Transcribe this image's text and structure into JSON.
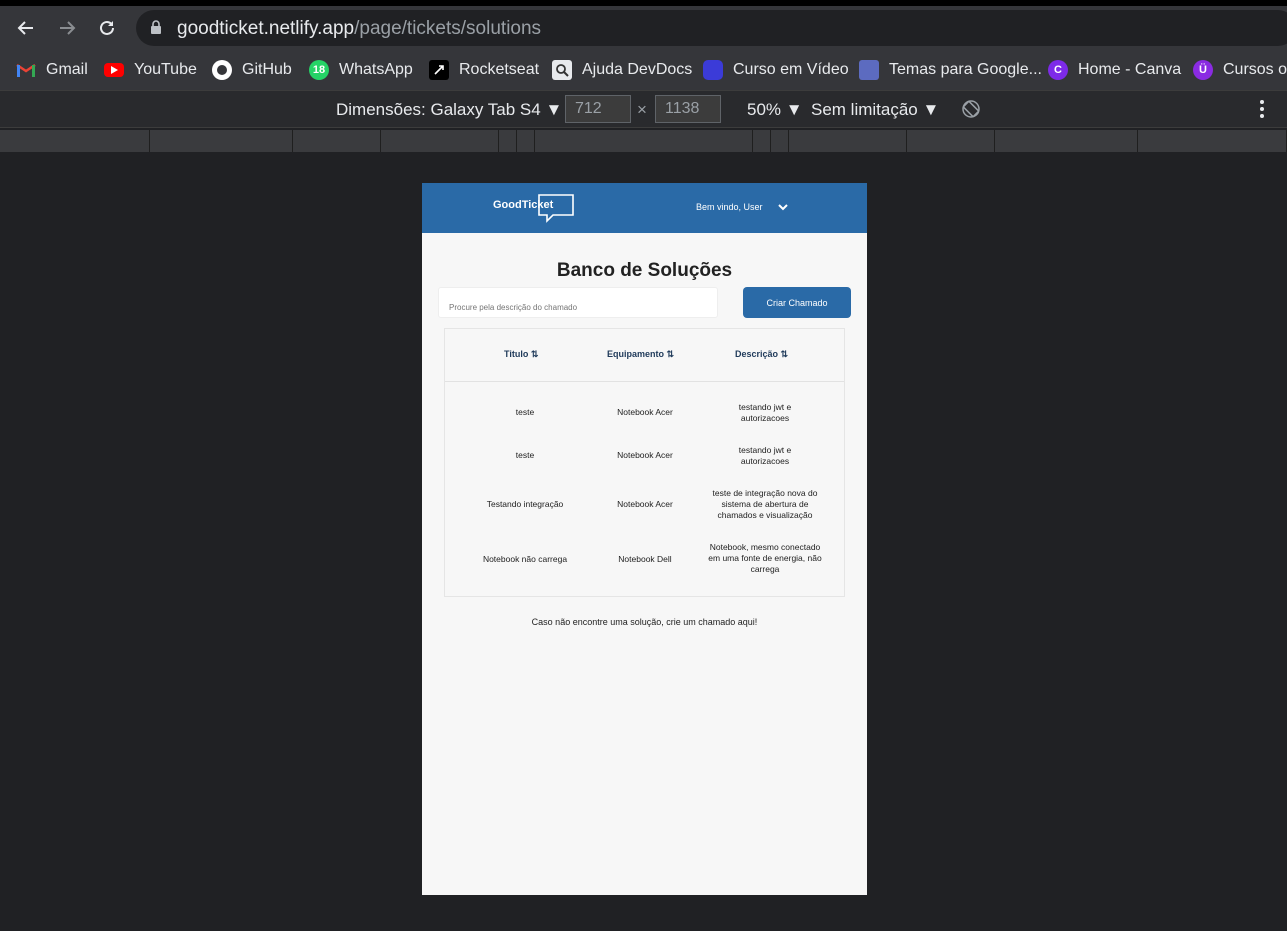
{
  "browser": {
    "url_host": "goodticket.netlify.app",
    "url_path": "/page/tickets/solutions",
    "bookmarks": [
      {
        "label": "Gmail",
        "icon": "gmail-icon"
      },
      {
        "label": "YouTube",
        "icon": "youtube-icon"
      },
      {
        "label": "GitHub",
        "icon": "github-icon"
      },
      {
        "label": "WhatsApp",
        "icon": "whatsapp-icon",
        "badge": "18"
      },
      {
        "label": "Rocketseat",
        "icon": "rocketseat-icon"
      },
      {
        "label": "Ajuda DevDocs",
        "icon": "devdocs-icon"
      },
      {
        "label": "Curso em Vídeo",
        "icon": "cursoemvideo-icon"
      },
      {
        "label": "Temas para Google...",
        "icon": "temas-icon"
      },
      {
        "label": "Home - Canva",
        "icon": "canva-icon",
        "badge": "C"
      },
      {
        "label": "Cursos on",
        "icon": "cursos-icon",
        "badge": "Ü"
      }
    ]
  },
  "devtools": {
    "device_label": "Dimensões: Galaxy Tab S4",
    "width_value": "712",
    "times_symbol": "×",
    "height_value": "1138",
    "zoom": "50%",
    "throttle": "Sem limitação"
  },
  "app": {
    "logo_text": "GoodTicket",
    "welcome": "Bem vindo, User",
    "page_title": "Banco de Soluções",
    "search_placeholder": "Procure pela descrição do chamado",
    "create_button": "Criar Chamado",
    "columns": [
      "Titulo ⇅",
      "Equipamento ⇅",
      "Descrição ⇅"
    ],
    "rows": [
      {
        "titulo": "teste",
        "equipamento": "Notebook Acer",
        "descricao": "testando jwt e autorizacoes"
      },
      {
        "titulo": "teste",
        "equipamento": "Notebook Acer",
        "descricao": "testando jwt e autorizacoes"
      },
      {
        "titulo": "Testando integração",
        "equipamento": "Notebook Acer",
        "descricao": "teste de integração nova do sistema de abertura de chamados e visualização"
      },
      {
        "titulo": "Notebook não carrega",
        "equipamento": "Notebook Dell",
        "descricao": "Notebook, mesmo conectado em uma fonte de energia, não carrega"
      }
    ],
    "footer_text": "Caso não encontre uma solução, crie um chamado aqui!"
  },
  "colors": {
    "brand": "#2a6aa7",
    "page_bg": "#f7f7f7",
    "chrome_bg": "#35363a"
  }
}
